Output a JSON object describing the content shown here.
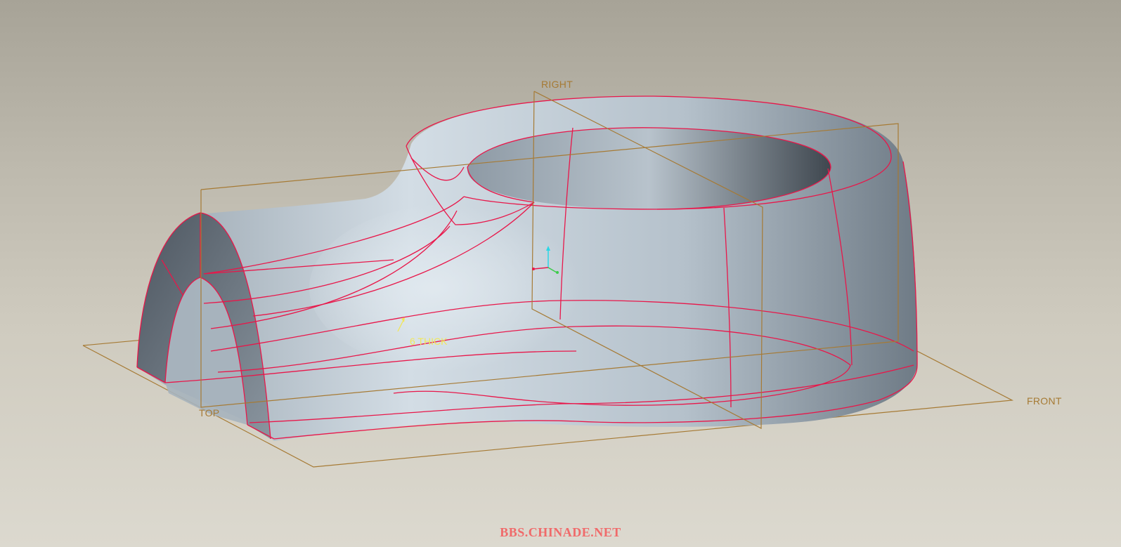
{
  "viewport": {
    "background_top": "#a7a397",
    "background_bottom": "#dcd9cf"
  },
  "colors": {
    "datum_plane": "#a67a34",
    "edge_highlight": "#e8174a",
    "dimension_text": "#f1e75a",
    "watermark": "#f06a6a",
    "csys_x": "#e8174a",
    "csys_y": "#2ad6e6",
    "csys_z": "#3ccc4a"
  },
  "datums": {
    "right": "RIGHT",
    "top": "TOP",
    "front": "FRONT"
  },
  "dimension": {
    "label": "6 THICK"
  },
  "watermark": "BBS.CHINADE.NET"
}
